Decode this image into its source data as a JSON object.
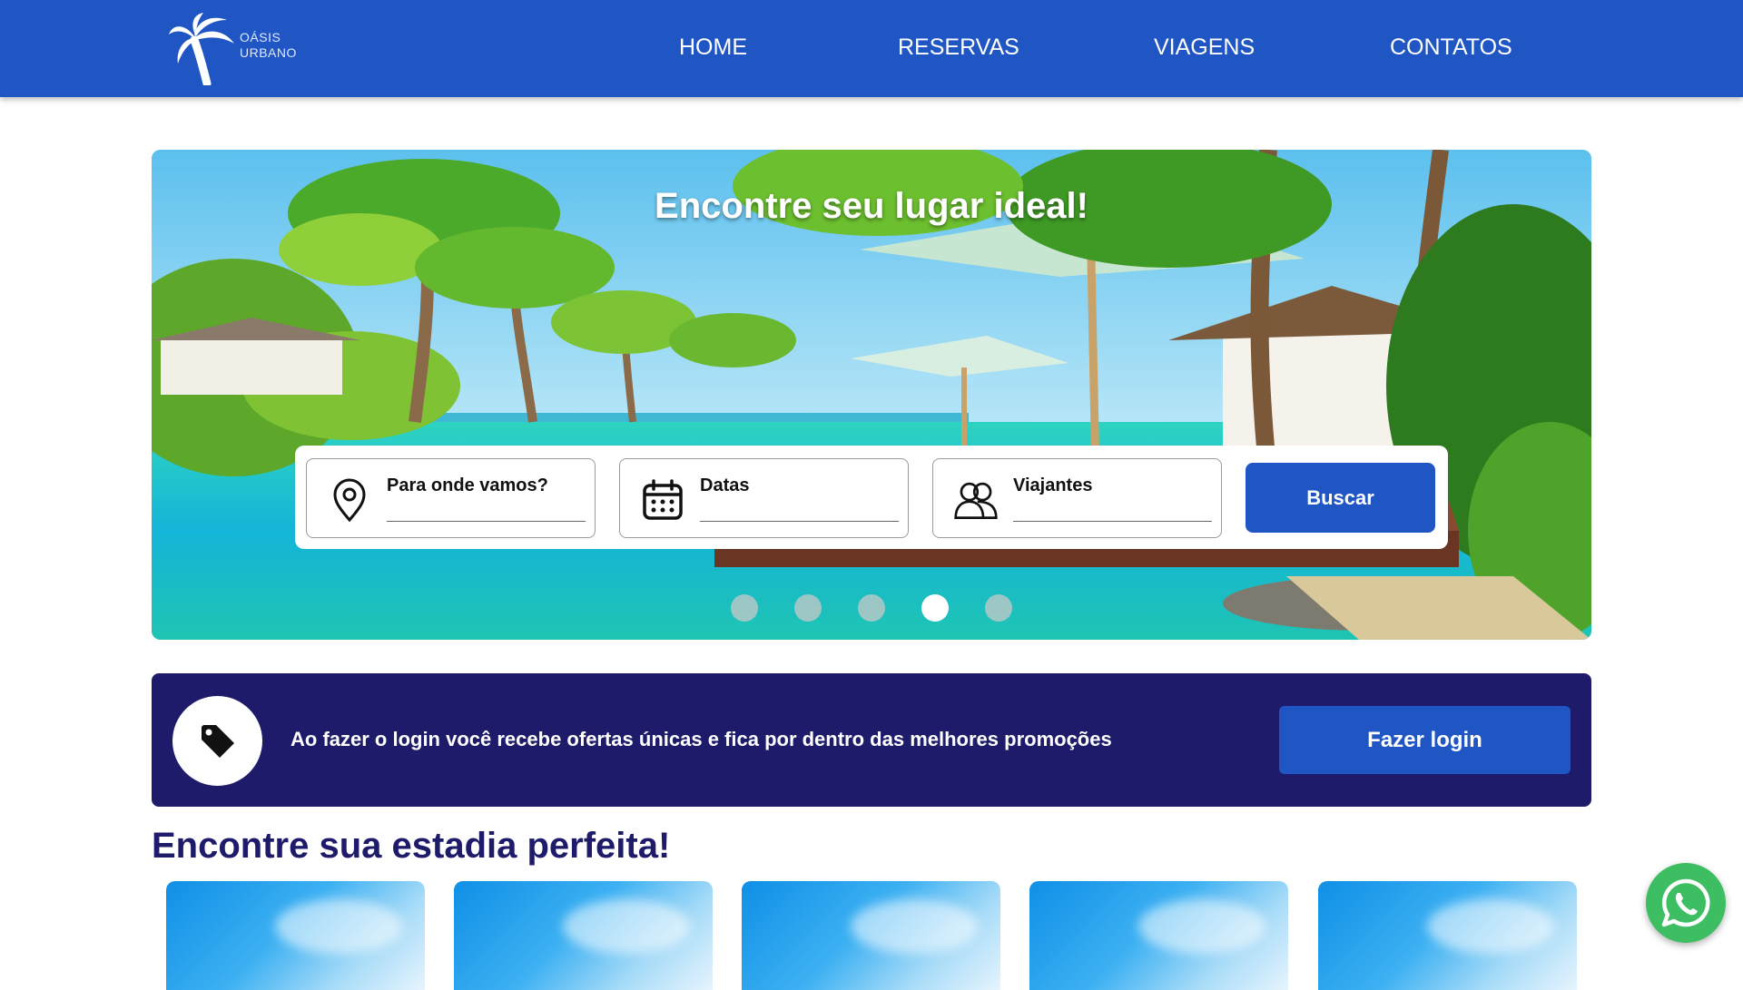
{
  "header": {
    "logo": {
      "line1": "OÁSIS",
      "line2": "URBANO",
      "icon": "palm-tree-icon"
    },
    "nav": [
      {
        "label": "HOME"
      },
      {
        "label": "RESERVAS"
      },
      {
        "label": "VIAGENS"
      },
      {
        "label": "CONTATOS"
      }
    ]
  },
  "hero": {
    "title": "Encontre seu lugar ideal!",
    "search": {
      "destination": {
        "label": "Para onde vamos?",
        "icon": "location-pin-icon",
        "value": ""
      },
      "dates": {
        "label": "Datas",
        "icon": "calendar-icon",
        "value": ""
      },
      "travelers": {
        "label": "Viajantes",
        "icon": "users-icon",
        "value": ""
      },
      "button": "Buscar"
    },
    "carousel": {
      "slides": 5,
      "active_index": 4
    }
  },
  "promo": {
    "icon": "tag-icon",
    "text": "Ao fazer o login você recebe ofertas únicas e fica por dentro das melhores promoções",
    "button": "Fazer login"
  },
  "stays": {
    "title": "Encontre sua estadia perfeita!",
    "cards": 5
  },
  "floating": {
    "icon": "whatsapp-icon"
  },
  "colors": {
    "header_blue": "#1f56c4",
    "promo_navy": "#1e1b6b",
    "whatsapp_green": "#3ebe63"
  }
}
